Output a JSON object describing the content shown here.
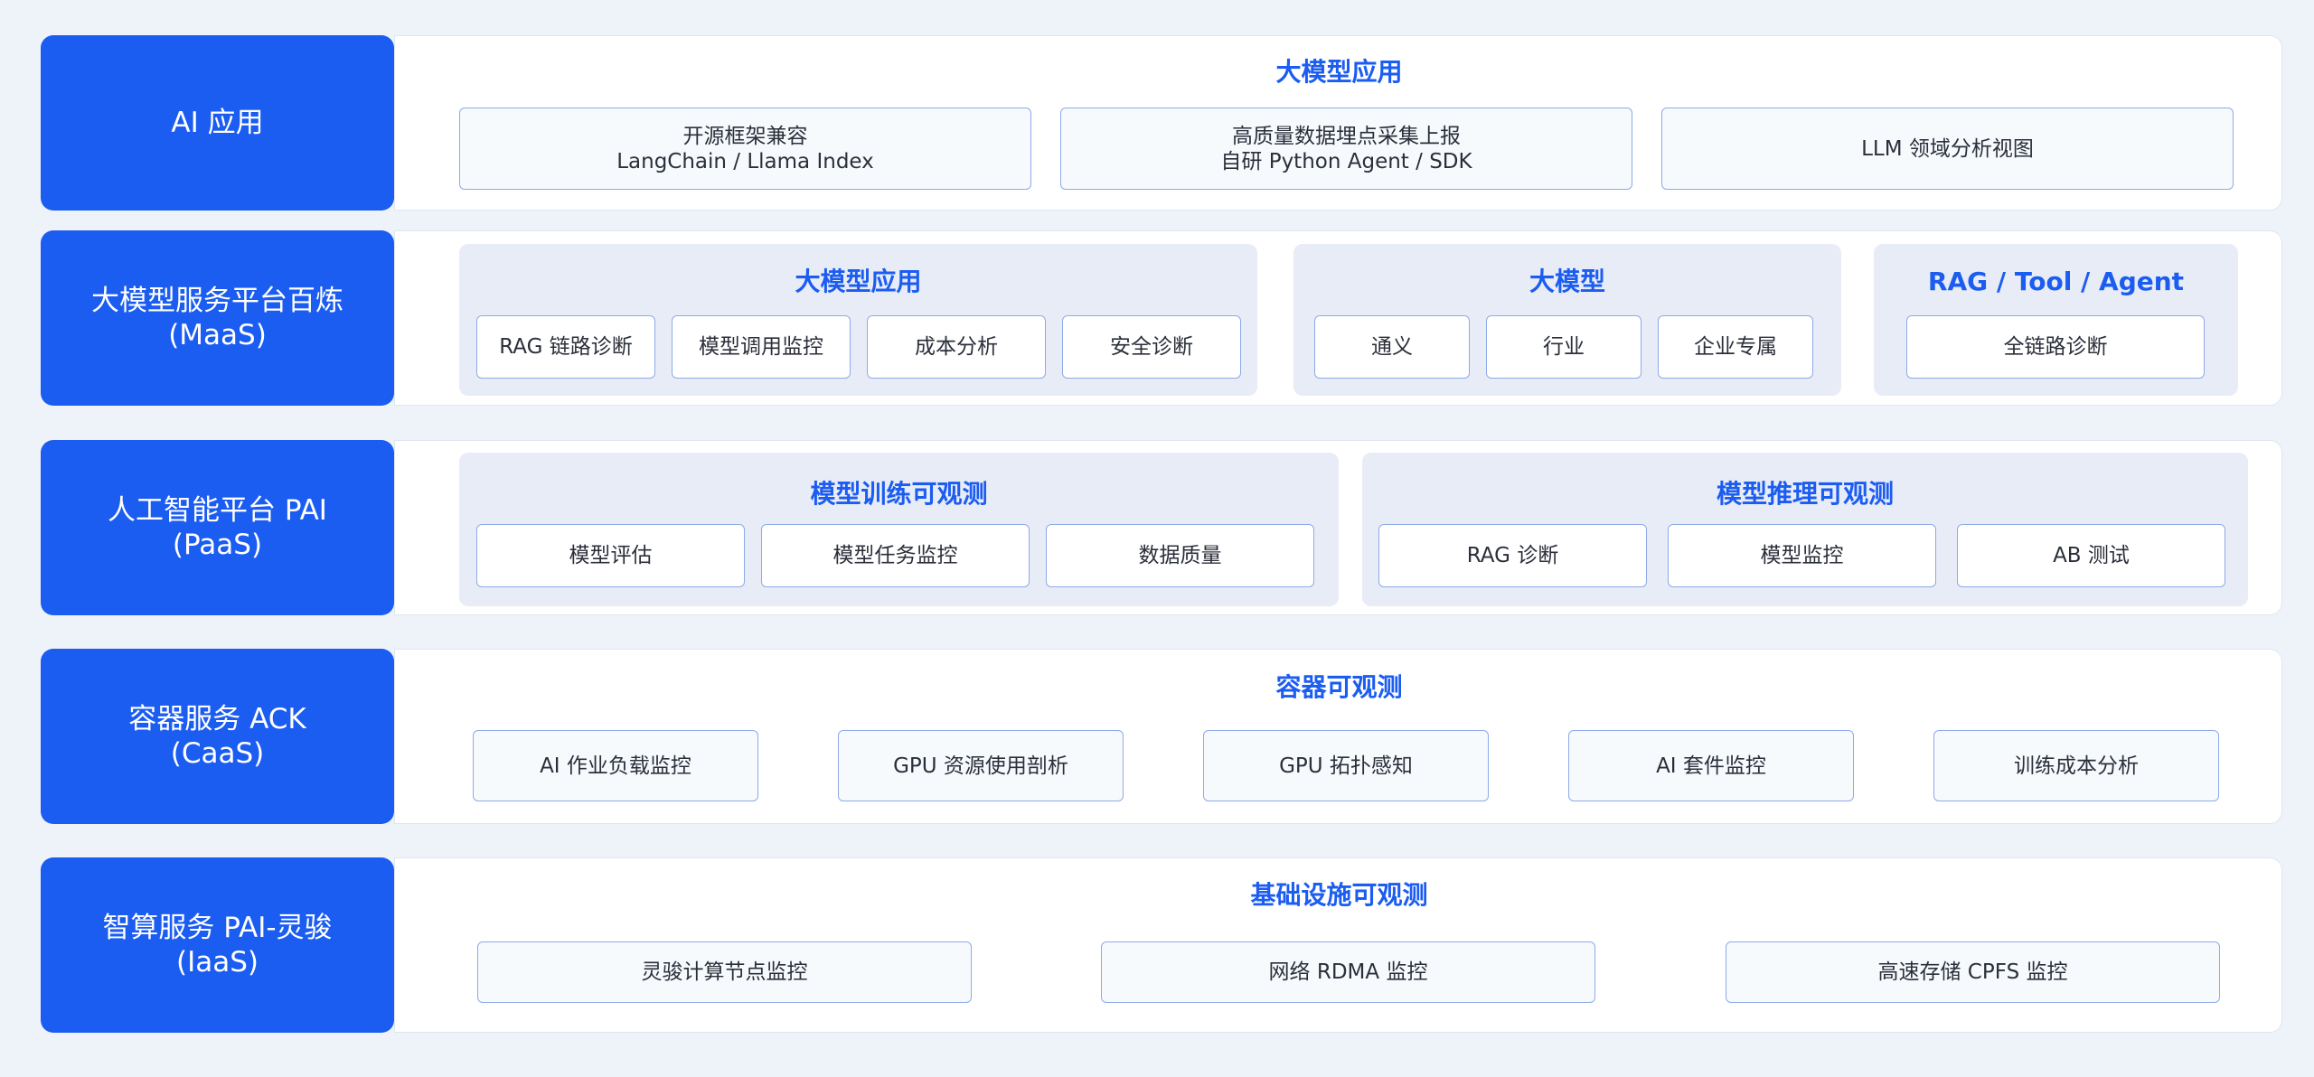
{
  "rows": [
    {
      "label": {
        "line1": "AI 应用",
        "line2": ""
      },
      "title": "大模型应用",
      "items": [
        {
          "line1": "开源框架兼容",
          "line2": "LangChain / Llama Index"
        },
        {
          "line1": "高质量数据埋点采集上报",
          "line2": "自研 Python Agent / SDK"
        },
        {
          "line1": "LLM 领域分析视图",
          "line2": ""
        }
      ]
    },
    {
      "label": {
        "line1": "大模型服务平台百炼",
        "line2": "(MaaS)"
      },
      "groups": [
        {
          "title": "大模型应用",
          "items": [
            "RAG 链路诊断",
            "模型调用监控",
            "成本分析",
            "安全诊断"
          ]
        },
        {
          "title": "大模型",
          "items": [
            "通义",
            "行业",
            "企业专属"
          ]
        },
        {
          "title": "RAG / Tool / Agent",
          "items": [
            "全链路诊断"
          ]
        }
      ]
    },
    {
      "label": {
        "line1": "人工智能平台 PAI",
        "line2": "(PaaS)"
      },
      "groups": [
        {
          "title": "模型训练可观测",
          "items": [
            "模型评估",
            "模型任务监控",
            "数据质量"
          ]
        },
        {
          "title": "模型推理可观测",
          "items": [
            "RAG 诊断",
            "模型监控",
            "AB 测试"
          ]
        }
      ]
    },
    {
      "label": {
        "line1": "容器服务 ACK",
        "line2": "(CaaS)"
      },
      "title": "容器可观测",
      "items": [
        "AI 作业负载监控",
        "GPU 资源使用剖析",
        "GPU 拓扑感知",
        "AI 套件监控",
        "训练成本分析"
      ]
    },
    {
      "label": {
        "line1": "智算服务 PAI-灵骏",
        "line2": "(IaaS)"
      },
      "title": "基础设施可观测",
      "items": [
        "灵骏计算节点监控",
        "网络 RDMA 监控",
        "高速存储 CPFS 监控"
      ]
    }
  ]
}
